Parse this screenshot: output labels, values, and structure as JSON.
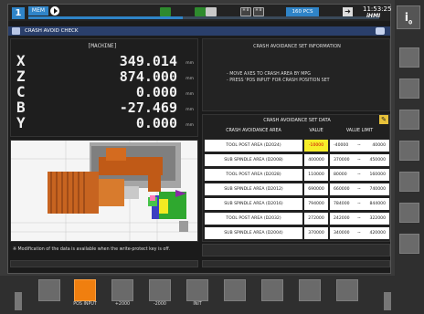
{
  "status": {
    "mode_number": "1",
    "mode": "MEM",
    "program_progress_percent": 44,
    "parts_count": "160 PCS",
    "time": "11:53:25",
    "brand": "iHMI",
    "indicator_box_1": "H B",
    "indicator_box_2": "H B"
  },
  "title": "CRASH AVOID CHECK",
  "machine": {
    "header": "[MACHINE]",
    "unit": "mm",
    "axes": [
      {
        "axis": "X",
        "value": "349.014"
      },
      {
        "axis": "Z",
        "value": "874.000"
      },
      {
        "axis": "C",
        "value": "0.000"
      },
      {
        "axis": "B",
        "value": "-27.469"
      },
      {
        "axis": "Y",
        "value": "0.000"
      }
    ]
  },
  "info": {
    "title": "CRASH AVOIDANCE SET INFORMATION",
    "lines": [
      "- MOVE AXES TO CRASH AREA BY MPG",
      "- PRESS 'POS INPUT' FOR CRASH POSITION SET"
    ]
  },
  "table": {
    "title": "CRASH AVOIDANCE SET DATA",
    "headers": {
      "area": "CRASH AVOIDANCE AREA",
      "value": "VALUE",
      "limit": "VALUE LIMIT"
    },
    "tilde": "~",
    "rows": [
      {
        "area": "TOOL POST AREA (D2024)",
        "value": "-10000",
        "lo": "-40000",
        "hi": "40000"
      },
      {
        "area": "SUB SPINDLE AREA (D2008)",
        "value": "400000",
        "lo": "370000",
        "hi": "450000"
      },
      {
        "area": "TOOL POST AREA (D2028)",
        "value": "110000",
        "lo": "80000",
        "hi": "160000"
      },
      {
        "area": "SUB SPINDLE AREA (D2012)",
        "value": "690000",
        "lo": "660000",
        "hi": "740000"
      },
      {
        "area": "SUB SPINDLE AREA (D2016)",
        "value": "794000",
        "lo": "784000",
        "hi": "844000"
      },
      {
        "area": "TOOL POST AREA (D2032)",
        "value": "272000",
        "lo": "242000",
        "hi": "322000"
      },
      {
        "area": "SUB SPINDLE AREA (D2004)",
        "value": "370000",
        "lo": "340000",
        "hi": "420000"
      }
    ]
  },
  "note": "※ Modification of the data is available when the write-protect key is off.",
  "softkeys": [
    {
      "label": "POS INPUT"
    },
    {
      "label": "+2000"
    },
    {
      "label": "-2000"
    },
    {
      "label": "INIT"
    }
  ],
  "colors": {
    "accent": "#2f84c8",
    "title_bar": "#2a3f6b",
    "highlight_value": "#f7ee2a",
    "active_softkey": "#f07f0f"
  }
}
